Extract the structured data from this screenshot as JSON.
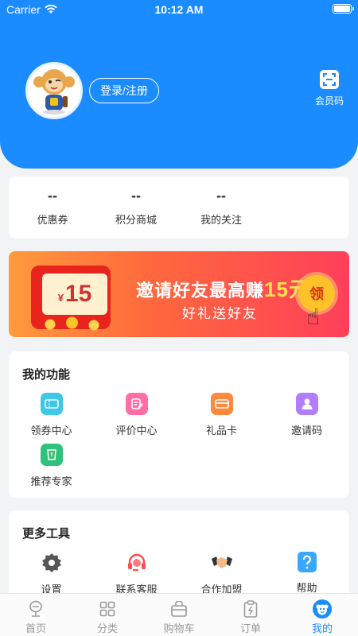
{
  "status_bar": {
    "carrier": "Carrier",
    "time": "10:12 AM"
  },
  "header": {
    "login_label": "登录/注册",
    "member_code_label": "会员码"
  },
  "stats": [
    {
      "value": "--",
      "label": "优惠券"
    },
    {
      "value": "--",
      "label": "积分商城"
    },
    {
      "value": "--",
      "label": "我的关注"
    }
  ],
  "banner": {
    "ticket_currency": "¥",
    "ticket_amount": "15",
    "title": "邀请好友最高赚",
    "title_amount": "15元",
    "subtitle": "好礼送好友",
    "claim_label": "领"
  },
  "features": {
    "title": "我的功能",
    "items": [
      {
        "label": "领券中心",
        "icon": "coupon-icon",
        "color": "#3ec7e6"
      },
      {
        "label": "评价中心",
        "icon": "review-icon",
        "color": "#ff6fa5"
      },
      {
        "label": "礼品卡",
        "icon": "gift-card-icon",
        "color": "#ff8a3d"
      },
      {
        "label": "邀请码",
        "icon": "invite-icon",
        "color": "#b27dff"
      },
      {
        "label": "推荐专家",
        "icon": "expert-icon",
        "color": "#2ec27a"
      }
    ]
  },
  "tools": {
    "title": "更多工具",
    "items": [
      {
        "label": "设置",
        "icon": "gear-icon",
        "color": "#555555"
      },
      {
        "label": "联系客服",
        "icon": "headset-icon",
        "color": "#ff4d4f"
      },
      {
        "label": "合作加盟",
        "icon": "handshake-icon",
        "color": "#f0a060"
      },
      {
        "label": "帮助",
        "icon": "help-icon",
        "color": "#3aa7ff"
      }
    ]
  },
  "tabbar": [
    {
      "label": "首页",
      "icon": "home-icon",
      "active": false
    },
    {
      "label": "分类",
      "icon": "category-icon",
      "active": false
    },
    {
      "label": "购物车",
      "icon": "cart-icon",
      "active": false
    },
    {
      "label": "订单",
      "icon": "order-icon",
      "active": false
    },
    {
      "label": "我的",
      "icon": "profile-icon",
      "active": true
    }
  ]
}
